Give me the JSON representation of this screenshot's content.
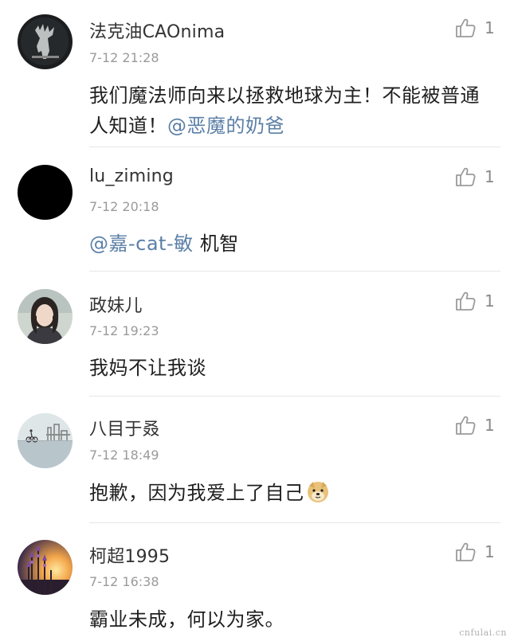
{
  "comments": [
    {
      "username": "法克油CAOnima",
      "time": "7-12 21:28",
      "text": "我们魔法师向来以拯救地球为主！不能被普通人知道！",
      "mention": "@恶魔的奶爸",
      "likes": "1",
      "avatar": "dark-artwork-avatar"
    },
    {
      "username": "lu_ziming",
      "time": "7-12 20:18",
      "mention": "@嘉-cat-敏",
      "text": " 机智",
      "likes": "1",
      "avatar": "black-avatar"
    },
    {
      "username": "政妹儿",
      "time": "7-12 19:23",
      "text": "我妈不让我谈",
      "likes": "1",
      "avatar": "portrait-avatar"
    },
    {
      "username": "八目于叒",
      "time": "7-12 18:49",
      "text": "抱歉，因为我爱上了自己",
      "likes": "1",
      "avatar": "lakeside-cyclist-avatar",
      "emoji": "doge-emoji"
    },
    {
      "username": "柯超1995",
      "time": "7-12 16:38",
      "text": "霸业未成，何以为家。",
      "likes": "1",
      "avatar": "sunset-flowers-avatar"
    }
  ],
  "watermark": "cnfulai.cn",
  "colors": {
    "mention": "#5b7fa6",
    "username": "#333333",
    "timestamp": "#9a9a9a",
    "divider": "#e6e6e6"
  }
}
